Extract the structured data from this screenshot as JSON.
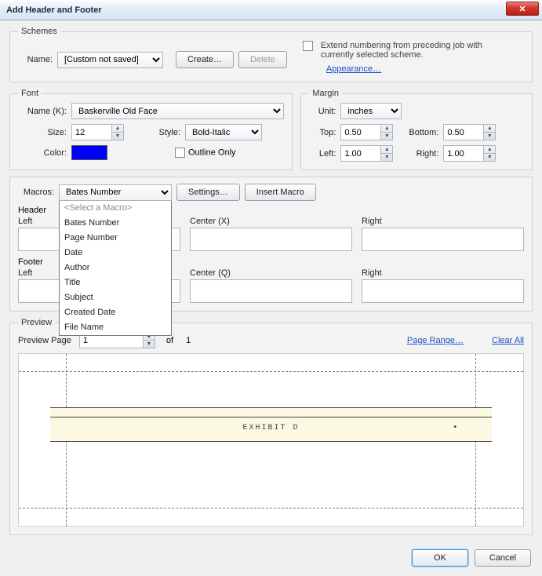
{
  "window": {
    "title": "Add Header and Footer"
  },
  "schemes": {
    "legend": "Schemes",
    "name_label": "Name:",
    "name_value": "[Custom not saved]",
    "create_btn": "Create…",
    "delete_btn": "Delete",
    "extend_cb_label": "Extend numbering from preceding job with currently selected scheme.",
    "appearance_link": "Appearance…"
  },
  "font": {
    "legend": "Font",
    "name_label": "Name (K):",
    "name_value": "Baskerville Old Face",
    "size_label": "Size:",
    "size_value": "12",
    "style_label": "Style:",
    "style_value": "Bold-Italic",
    "color_label": "Color:",
    "outline_cb_label": "Outline Only"
  },
  "margin": {
    "legend": "Margin",
    "unit_label": "Unit:",
    "unit_value": "inches",
    "top_label": "Top:",
    "top_value": "0.50",
    "bottom_label": "Bottom:",
    "bottom_value": "0.50",
    "left_label": "Left:",
    "left_value": "1.00",
    "right_label": "Right:",
    "right_value": "1.00"
  },
  "macros": {
    "label": "Macros:",
    "selected": "Bates Number",
    "settings_btn": "Settings…",
    "insert_btn": "Insert Macro",
    "options": [
      "<Select a Macro>",
      "Bates Number",
      "Page Number",
      "Date",
      "Author",
      "Title",
      "Subject",
      "Created Date",
      "File Name"
    ]
  },
  "header": {
    "label": "Header",
    "left_label": "Left",
    "center_label": "Center (X)",
    "right_label": "Right"
  },
  "footer": {
    "label": "Footer",
    "left_label": "Left",
    "center_label": "Center (Q)",
    "right_label": "Right"
  },
  "preview": {
    "legend": "Preview",
    "page_label": "Preview Page",
    "page_value": "1",
    "of_label": "of",
    "total_pages": "1",
    "page_range_link": "Page Range…",
    "clear_all_link": "Clear All",
    "doc_text": "EXHIBIT D"
  },
  "buttons": {
    "ok": "OK",
    "cancel": "Cancel"
  }
}
